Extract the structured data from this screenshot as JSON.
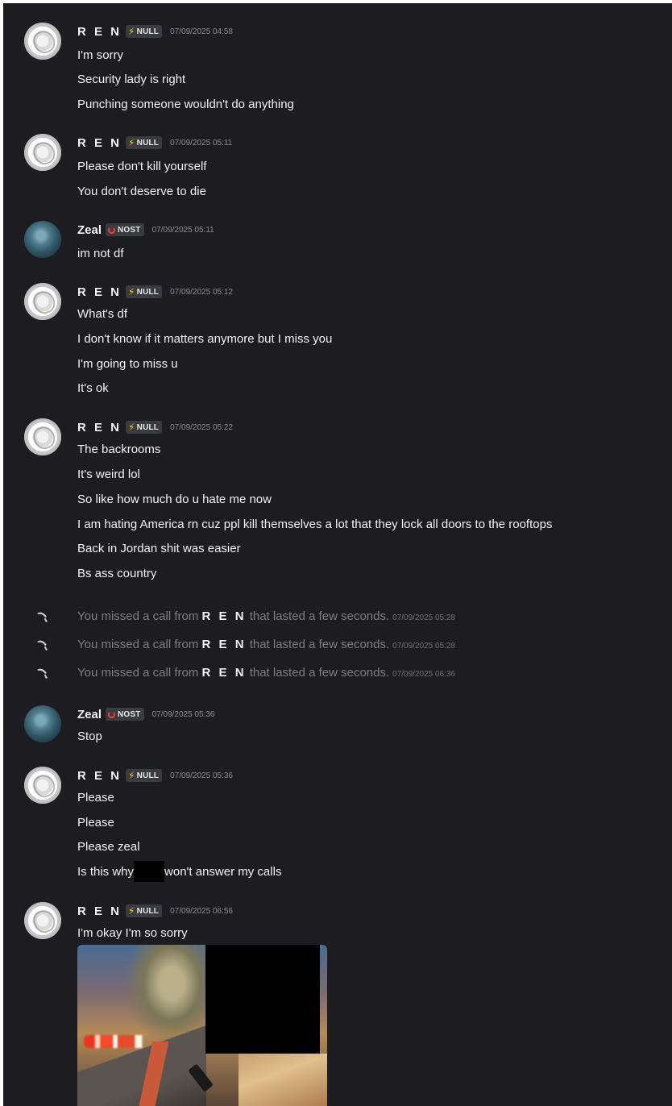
{
  "users": {
    "ren": {
      "name": "R E N",
      "tag": "NULL"
    },
    "zeal": {
      "name": "Zeal",
      "tag": "NOST"
    }
  },
  "messages": [
    {
      "author": "R E N",
      "tag": "NULL",
      "time": "07/09/2025 04:58",
      "lines": [
        "I'm sorry",
        "Security lady is right",
        "Punching someone wouldn't do anything"
      ]
    },
    {
      "author": "R E N",
      "tag": "NULL",
      "time": "07/09/2025 05:11",
      "lines": [
        "Please don't kill yourself",
        "You don't deserve to die"
      ]
    },
    {
      "author": "Zeal",
      "tag": "NOST",
      "time": "07/09/2025 05:11",
      "lines": [
        "im not df"
      ]
    },
    {
      "author": "R E N",
      "tag": "NULL",
      "time": "07/09/2025 05:12",
      "lines": [
        "What's df",
        "I don't know if it matters anymore but I miss you",
        "I'm going to miss u",
        "It's ok"
      ]
    },
    {
      "author": "R E N",
      "tag": "NULL",
      "time": "07/09/2025 05:22",
      "lines": [
        "The backrooms",
        "It's weird lol",
        "So like how much do u hate me now",
        "I am hating America rn cuz ppl kill themselves a lot that they lock all doors to the rooftops",
        "Back in Jordan shit was easier",
        "Bs ass country"
      ]
    },
    {
      "author": "Zeal",
      "tag": "NOST",
      "time": "07/09/2025 05:36",
      "lines": [
        "Stop"
      ]
    },
    {
      "author": "R E N",
      "tag": "NULL",
      "time": "07/09/2025 05:36",
      "lines": [
        "Please",
        "Please",
        "Please zeal",
        "Is this why",
        "won't answer my calls"
      ]
    },
    {
      "author": "R E N",
      "tag": "NULL",
      "time": "07/09/2025 06:56",
      "lines": [
        "I'm okay I'm so sorry"
      ]
    }
  ],
  "calls": [
    {
      "prefix": "You missed a call from ",
      "caller": "R E N",
      "suffix": " that lasted a few seconds.",
      "time": "07/09/2025 05:28"
    },
    {
      "prefix": "You missed a call from ",
      "caller": "R E N",
      "suffix": " that lasted a few seconds.",
      "time": "07/09/2025 05:28"
    },
    {
      "prefix": "You missed a call from ",
      "caller": "R E N",
      "suffix": " that lasted a few seconds.",
      "time": "07/09/2025 06:36"
    }
  ],
  "icons": {
    "call": "phone-icon",
    "ren_badge": "lightning-bolt-icon",
    "zeal_badge": "ring-icon"
  },
  "colors": {
    "background": "#1d1d21",
    "text": "#f2f3f5",
    "muted": "#8b8d93",
    "bolt": "#f5d000",
    "ring": "#e8403a"
  }
}
